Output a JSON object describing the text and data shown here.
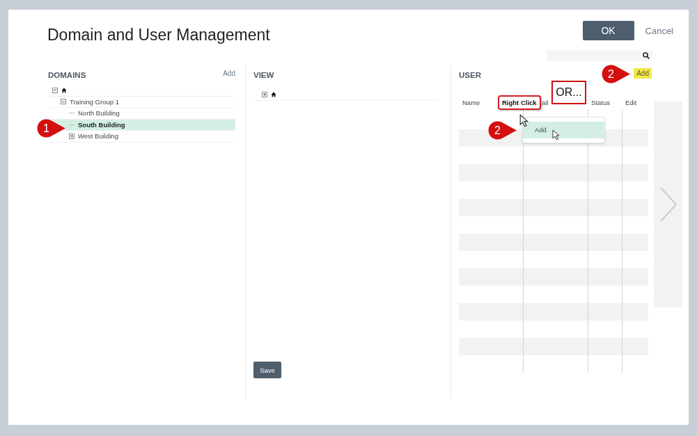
{
  "dialog": {
    "title": "Domain and User Management",
    "ok_button": "OK",
    "cancel_button": "Cancel"
  },
  "domains": {
    "heading": "DOMAINS",
    "add_link": "Add",
    "tree": [
      {
        "expanded": true,
        "selected": false,
        "children": [
          {
            "label": "Training Group 1",
            "expanded": true,
            "selected": false,
            "children": [
              {
                "label": "North Building",
                "selected": false
              },
              {
                "label": "South Building",
                "selected": true
              },
              {
                "label": "West Building",
                "expanded": false,
                "selected": false
              }
            ]
          }
        ]
      }
    ]
  },
  "view": {
    "heading": "VIEW",
    "tree": [
      {
        "expanded": false,
        "selected": false
      }
    ],
    "save_button": "Save"
  },
  "user": {
    "heading": "USER",
    "add_link": "Add",
    "columns": [
      "Name",
      "ail",
      "Status",
      "Edit"
    ],
    "context_menu": [
      {
        "label": "Add",
        "selected": true
      }
    ]
  },
  "annotations": [
    {
      "kind": "marker",
      "text": "1"
    },
    {
      "kind": "marker",
      "text": "2"
    },
    {
      "kind": "marker",
      "text": "2"
    },
    {
      "kind": "callout",
      "text": "Right Click"
    },
    {
      "kind": "box",
      "text": "OR..."
    }
  ]
}
